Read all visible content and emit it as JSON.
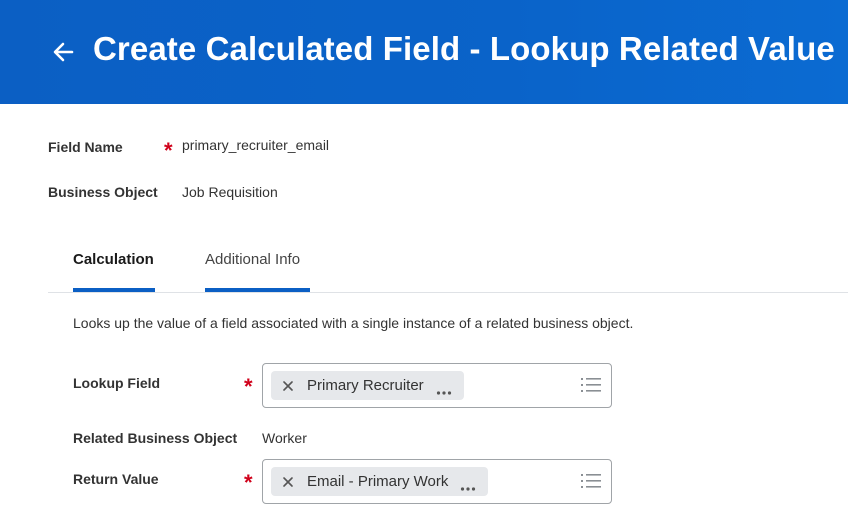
{
  "header": {
    "title": "Create Calculated Field - Lookup Related Value",
    "back_icon": "arrow-left-icon",
    "background": "#0b5fc4"
  },
  "fields": {
    "field_name": {
      "label": "Field Name",
      "value": "primary_recruiter_email",
      "required": true
    },
    "business_object": {
      "label": "Business Object",
      "value": "Job Requisition"
    }
  },
  "tabs": [
    {
      "label": "Calculation",
      "active": true
    },
    {
      "label": "Additional Info",
      "active": false
    }
  ],
  "calculation": {
    "description": "Looks up the value of a field associated with a single instance of a related business object.",
    "lookup_field": {
      "label": "Lookup Field",
      "required": true,
      "selected": "Primary Recruiter"
    },
    "related_business_object": {
      "label": "Related Business Object",
      "value": "Worker"
    },
    "return_value": {
      "label": "Return Value",
      "required": true,
      "selected": "Email - Primary Work"
    }
  },
  "colors": {
    "accent": "#0b5fc4",
    "required": "#d0021b",
    "pill": "#e6e8eb"
  },
  "required_marker": "*"
}
